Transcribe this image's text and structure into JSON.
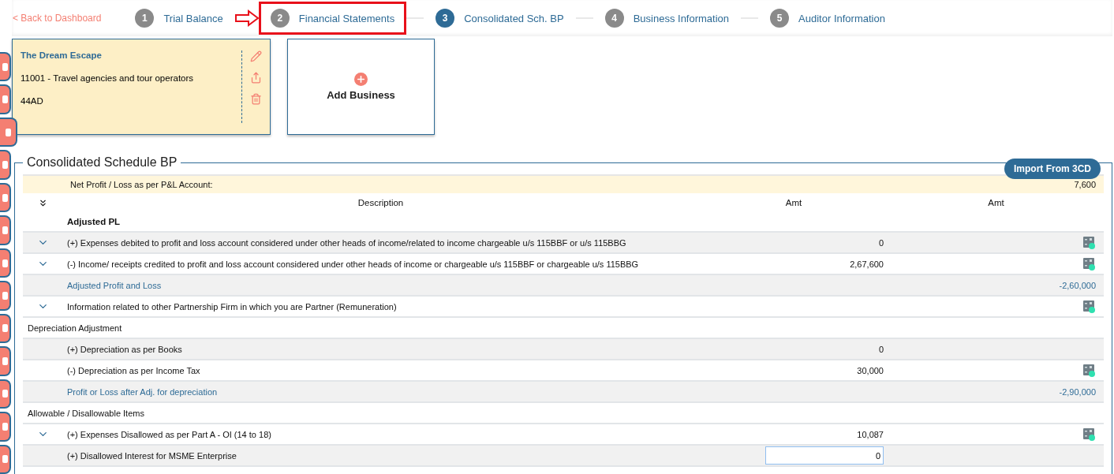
{
  "back_link": "< Back to Dashboard",
  "steps": [
    {
      "number": "1",
      "label": "Trial Balance",
      "selected": false,
      "highlighted": false
    },
    {
      "number": "2",
      "label": "Financial Statements",
      "selected": false,
      "highlighted": true
    },
    {
      "number": "3",
      "label": "Consolidated Sch. BP",
      "selected": true,
      "highlighted": false
    },
    {
      "number": "4",
      "label": "Business Information",
      "selected": false,
      "highlighted": false
    },
    {
      "number": "5",
      "label": "Auditor Information",
      "selected": false,
      "highlighted": false
    }
  ],
  "side_tabs": [
    {
      "selected": false
    },
    {
      "selected": false
    },
    {
      "selected": true
    },
    {
      "selected": false
    },
    {
      "selected": false
    },
    {
      "selected": false
    },
    {
      "selected": false
    },
    {
      "selected": false
    },
    {
      "selected": false
    },
    {
      "selected": false
    },
    {
      "selected": false
    },
    {
      "selected": false
    },
    {
      "selected": false
    }
  ],
  "business_card": {
    "name": "The Dream Escape",
    "code": "11001 - Travel agencies and tour operators",
    "section": "44AD"
  },
  "add_business": {
    "label": "Add Business"
  },
  "schedule": {
    "title": "Consolidated Schedule BP",
    "import_button": "Import From 3CD",
    "net_profit": {
      "label": "Net Profit / Loss as per P&L Account:",
      "amount": "7,600"
    },
    "columns": {
      "description": "Description",
      "amt_1": "Amt",
      "amt_2": "Amt",
      "group": "Adjusted PL"
    },
    "rows": [
      {
        "kind": "expandable",
        "label": "(+) Expenses debited to profit and loss account considered under other heads of income/related to income chargeable u/s 115BBF or u/s 115BBG",
        "amt_1": "0",
        "calculator": true
      },
      {
        "kind": "expandable",
        "label": "(-) Income/ receipts credited to profit and loss account considered under other heads of income or chargeable u/s 115BBF or chargeable u/s 115BBG",
        "amt_1": "2,67,600",
        "calculator": true
      },
      {
        "kind": "total",
        "label": "Adjusted Profit and Loss",
        "amt_2": "-2,60,000",
        "calculator": false
      },
      {
        "kind": "expandable",
        "label": "Information related to other Partnership Firm in which you are Partner (Remuneration)",
        "calculator": true
      },
      {
        "kind": "section",
        "label": "Depreciation Adjustment",
        "calculator": false
      },
      {
        "kind": "plain",
        "label": "(+) Depreciation as per Books",
        "amt_1": "0",
        "calculator": false
      },
      {
        "kind": "plain",
        "label": "(-) Depreciation as per Income Tax",
        "amt_1": "30,000",
        "calculator": true
      },
      {
        "kind": "total",
        "label": "Profit or Loss after Adj. for depreciation",
        "amt_2": "-2,90,000",
        "calculator": false
      },
      {
        "kind": "section",
        "label": "Allowable / Disallowable Items",
        "calculator": false
      },
      {
        "kind": "expandable",
        "label": "(+) Expenses Disallowed as per Part A - OI (14 to 18)",
        "amt_1": "10,087",
        "calculator": true
      },
      {
        "kind": "input",
        "label": "(+) Disallowed Interest for MSME Enterprise",
        "amt_1": "0",
        "calculator": false
      }
    ]
  }
}
